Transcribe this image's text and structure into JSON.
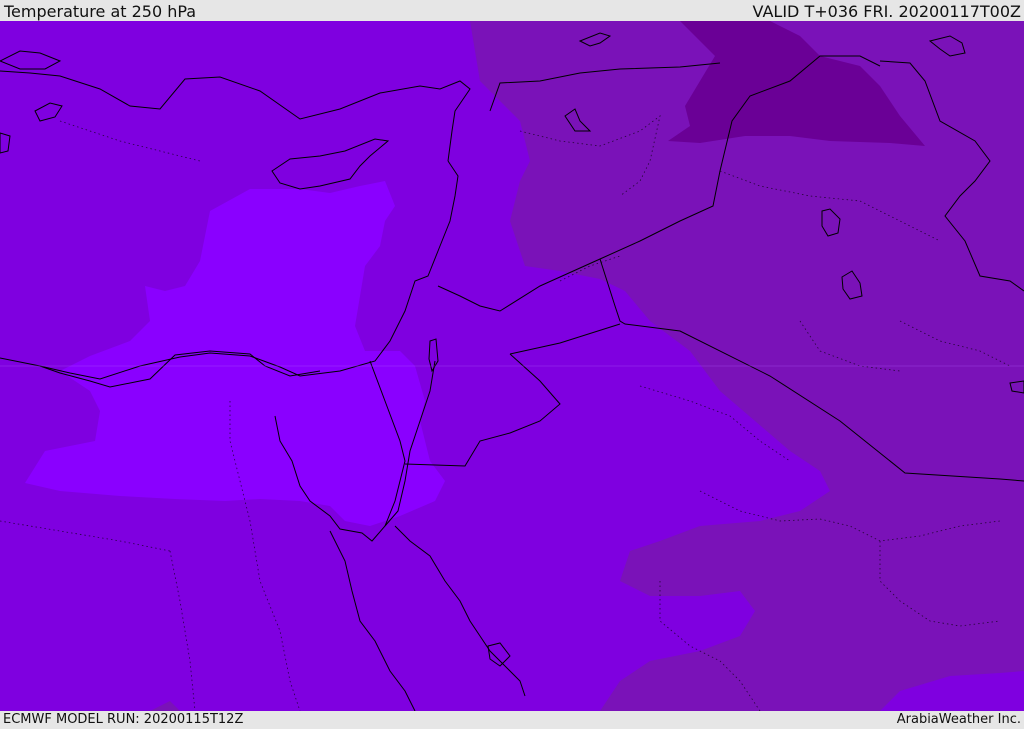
{
  "header": {
    "title": "Temperature at 250 hPa",
    "valid": "VALID T+036 FRI. 20200117T00Z"
  },
  "footer": {
    "model_run": "ECMWF MODEL RUN: 20200115T12Z",
    "credit": "ArabiaWeather Inc."
  },
  "map": {
    "colors": {
      "band_cold": "#6a0096",
      "band_cool": "#7a12b8",
      "band_mid": "#7f00e0",
      "band_warm": "#8a00ff",
      "coastline": "#000000",
      "graticule": "#b35cff"
    }
  }
}
